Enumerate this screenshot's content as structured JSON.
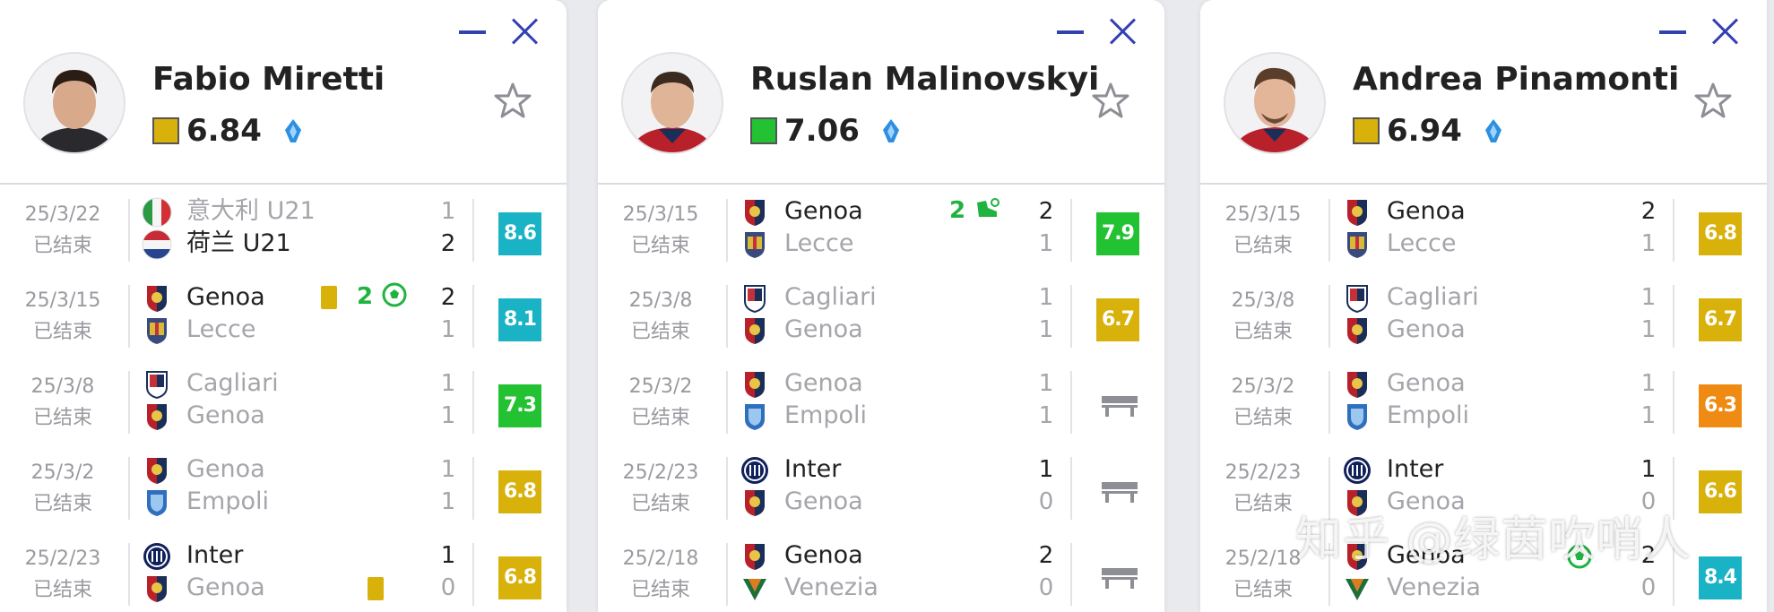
{
  "cards": [
    {
      "name": "Fabio Miretti",
      "rating": "6.84",
      "rating_color": "#d8b10b",
      "matches": [
        {
          "date": "25/3/22",
          "status": "已结束",
          "home": "意大利 U21",
          "away": "荷兰 U21",
          "home_score": "1",
          "away_score": "2",
          "home_crest": "italy-flag",
          "away_crest": "netherlands-flag",
          "badge": "8.6",
          "badge_color": "#1ab3c6",
          "winner": "away"
        },
        {
          "date": "25/3/15",
          "status": "已结束",
          "home": "Genoa",
          "away": "Lecce",
          "home_score": "2",
          "away_score": "1",
          "home_crest": "genoa-crest",
          "away_crest": "lecce-crest",
          "badge": "8.1",
          "badge_color": "#1ab3c6",
          "winner": "home",
          "event_text": "2"
        },
        {
          "date": "25/3/8",
          "status": "已结束",
          "home": "Cagliari",
          "away": "Genoa",
          "home_score": "1",
          "away_score": "1",
          "home_crest": "cagliari-crest",
          "away_crest": "genoa-crest",
          "badge": "7.3",
          "badge_color": "#22c232",
          "winner": "none"
        },
        {
          "date": "25/3/2",
          "status": "已结束",
          "home": "Genoa",
          "away": "Empoli",
          "home_score": "1",
          "away_score": "1",
          "home_crest": "genoa-crest",
          "away_crest": "empoli-crest",
          "badge": "6.8",
          "badge_color": "#d8b10b",
          "winner": "none"
        },
        {
          "date": "25/2/23",
          "status": "已结束",
          "home": "Inter",
          "away": "Genoa",
          "home_score": "1",
          "away_score": "0",
          "home_crest": "inter-crest",
          "away_crest": "genoa-crest",
          "badge": "6.8",
          "badge_color": "#d8b10b",
          "winner": "home"
        }
      ]
    },
    {
      "name": "Ruslan Malinovskyi",
      "rating": "7.06",
      "rating_color": "#22c232",
      "matches": [
        {
          "date": "25/3/15",
          "status": "已结束",
          "home": "Genoa",
          "away": "Lecce",
          "home_score": "2",
          "away_score": "1",
          "home_crest": "genoa-crest",
          "away_crest": "lecce-crest",
          "badge": "7.9",
          "badge_color": "#22c232",
          "winner": "home",
          "event_text": "2"
        },
        {
          "date": "25/3/8",
          "status": "已结束",
          "home": "Cagliari",
          "away": "Genoa",
          "home_score": "1",
          "away_score": "1",
          "home_crest": "cagliari-crest",
          "away_crest": "genoa-crest",
          "badge": "6.7",
          "badge_color": "#d8b10b",
          "winner": "none"
        },
        {
          "date": "25/3/2",
          "status": "已结束",
          "home": "Genoa",
          "away": "Empoli",
          "home_score": "1",
          "away_score": "1",
          "home_crest": "genoa-crest",
          "away_crest": "empoli-crest",
          "badge": "",
          "winner": "none",
          "bench": true
        },
        {
          "date": "25/2/23",
          "status": "已结束",
          "home": "Inter",
          "away": "Genoa",
          "home_score": "1",
          "away_score": "0",
          "home_crest": "inter-crest",
          "away_crest": "genoa-crest",
          "badge": "",
          "winner": "home",
          "bench": true
        },
        {
          "date": "25/2/18",
          "status": "已结束",
          "home": "Genoa",
          "away": "Venezia",
          "home_score": "2",
          "away_score": "0",
          "home_crest": "genoa-crest",
          "away_crest": "venezia-crest",
          "badge": "",
          "winner": "home",
          "bench": true
        }
      ]
    },
    {
      "name": "Andrea Pinamonti",
      "rating": "6.94",
      "rating_color": "#d8b10b",
      "matches": [
        {
          "date": "25/3/15",
          "status": "已结束",
          "home": "Genoa",
          "away": "Lecce",
          "home_score": "2",
          "away_score": "1",
          "home_crest": "genoa-crest",
          "away_crest": "lecce-crest",
          "badge": "6.8",
          "badge_color": "#d8b10b",
          "winner": "home"
        },
        {
          "date": "25/3/8",
          "status": "已结束",
          "home": "Cagliari",
          "away": "Genoa",
          "home_score": "1",
          "away_score": "1",
          "home_crest": "cagliari-crest",
          "away_crest": "genoa-crest",
          "badge": "6.7",
          "badge_color": "#d8b10b",
          "winner": "none"
        },
        {
          "date": "25/3/2",
          "status": "已结束",
          "home": "Genoa",
          "away": "Empoli",
          "home_score": "1",
          "away_score": "1",
          "home_crest": "genoa-crest",
          "away_crest": "empoli-crest",
          "badge": "6.3",
          "badge_color": "#ef8a12",
          "winner": "none"
        },
        {
          "date": "25/2/23",
          "status": "已结束",
          "home": "Inter",
          "away": "Genoa",
          "home_score": "1",
          "away_score": "0",
          "home_crest": "inter-crest",
          "away_crest": "genoa-crest",
          "badge": "6.6",
          "badge_color": "#d8b10b",
          "winner": "home"
        },
        {
          "date": "25/2/18",
          "status": "已结束",
          "home": "Genoa",
          "away": "Venezia",
          "home_score": "2",
          "away_score": "0",
          "home_crest": "genoa-crest",
          "away_crest": "venezia-crest",
          "badge": "8.4",
          "badge_color": "#1ab3c6",
          "winner": "home"
        }
      ]
    }
  ],
  "watermark": "知乎 @绿茵吹哨人",
  "colors": {
    "accent": "#3340b0",
    "green": "#21b33f",
    "yellow": "#d8b10b",
    "teal": "#1ab3c6",
    "orange": "#ef8a12"
  }
}
